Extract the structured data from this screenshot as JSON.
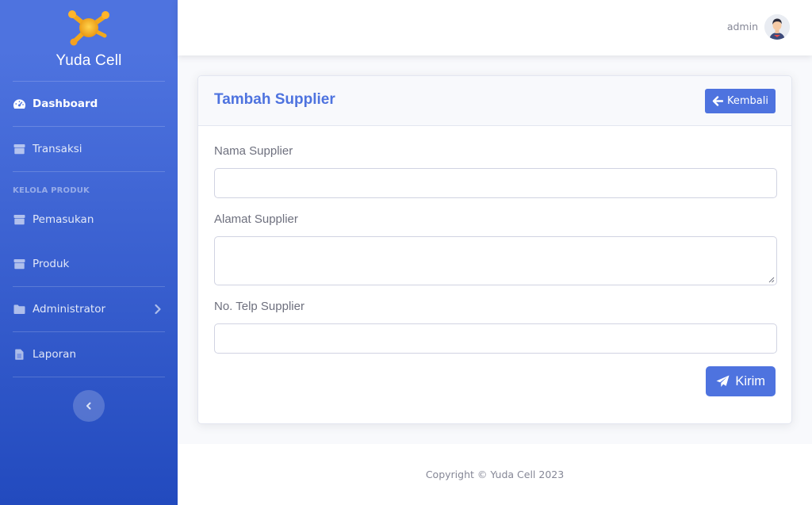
{
  "sidebar": {
    "brand": "Yuda Cell",
    "items": [
      {
        "label": "Dashboard",
        "icon": "tachometer-icon"
      },
      {
        "label": "Transaksi",
        "icon": "box-icon"
      },
      {
        "label": "Pemasukan",
        "icon": "box-icon"
      },
      {
        "label": "Produk",
        "icon": "box-icon"
      },
      {
        "label": "Administrator",
        "icon": "folder-icon"
      },
      {
        "label": "Laporan",
        "icon": "file-icon"
      }
    ],
    "heading": "KELOLA PRODUK"
  },
  "topbar": {
    "user": "admin"
  },
  "card": {
    "title": "Tambah Supplier",
    "back_label": "Kembali",
    "fields": {
      "nama_label": "Nama Supplier",
      "nama_value": "",
      "alamat_label": "Alamat Supplier",
      "alamat_value": "",
      "telp_label": "No. Telp Supplier",
      "telp_value": ""
    },
    "submit_label": "Kirim"
  },
  "footer": {
    "copyright": "Copyright © Yuda Cell 2023"
  },
  "colors": {
    "primary": "#4e73df",
    "sidebar_bottom": "#224abe"
  }
}
